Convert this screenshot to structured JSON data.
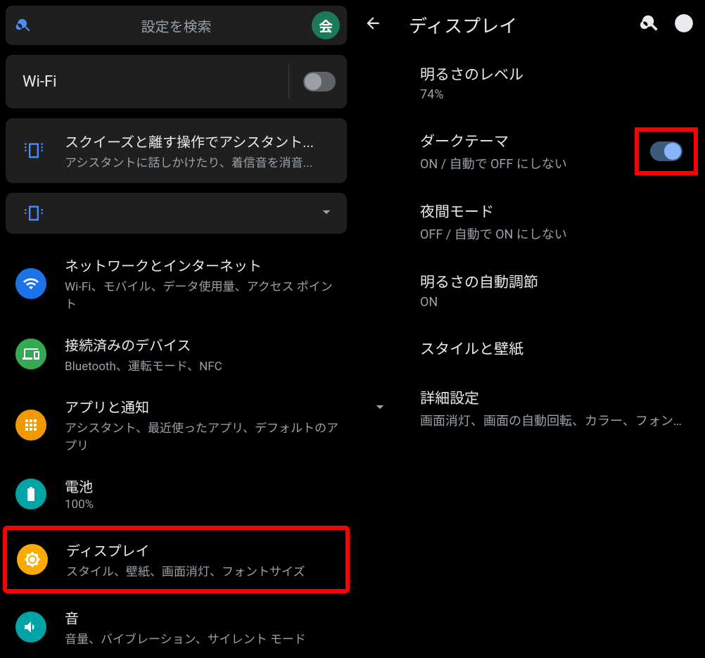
{
  "left": {
    "search_placeholder": "設定を検索",
    "voice_label": "会",
    "wifi_label": "Wi-Fi",
    "squeeze": {
      "title": "スクイーズと離す操作でアシスタント...",
      "sub": "アシスタントに話しかけたり、着信音を消音..."
    },
    "items": [
      {
        "title": "ネットワークとインターネット",
        "sub": "Wi-Fi、モバイル、データ使用量、アクセス ポイント",
        "color": "ic-blue",
        "icon": "wifi"
      },
      {
        "title": "接続済みのデバイス",
        "sub": "Bluetooth、運転モード、NFC",
        "color": "ic-green",
        "icon": "devices"
      },
      {
        "title": "アプリと通知",
        "sub": "アシスタント、最近使ったアプリ、デフォルトのアプリ",
        "color": "ic-orange",
        "icon": "apps"
      },
      {
        "title": "電池",
        "sub": "100%",
        "color": "ic-teal",
        "icon": "battery"
      },
      {
        "title": "ディスプレイ",
        "sub": "スタイル、壁紙、画面消灯、フォントサイズ",
        "color": "ic-amber",
        "icon": "brightness"
      },
      {
        "title": "音",
        "sub": "音量、バイブレーション、サイレント モード",
        "color": "ic-teal",
        "icon": "volume"
      }
    ]
  },
  "right": {
    "title": "ディスプレイ",
    "items": [
      {
        "title": "明るさのレベル",
        "sub": "74%"
      },
      {
        "title": "ダークテーマ",
        "sub": "ON / 自動で OFF にしない",
        "toggle_on": true,
        "highlight": true
      },
      {
        "title": "夜間モード",
        "sub": "OFF / 自動で ON にしない"
      },
      {
        "title": "明るさの自動調節",
        "sub": "ON"
      },
      {
        "title": "スタイルと壁紙",
        "sub": ""
      },
      {
        "title": "詳細設定",
        "sub": "画面消灯、画面の自動回転、カラー、フォント...",
        "expand": true
      }
    ]
  }
}
